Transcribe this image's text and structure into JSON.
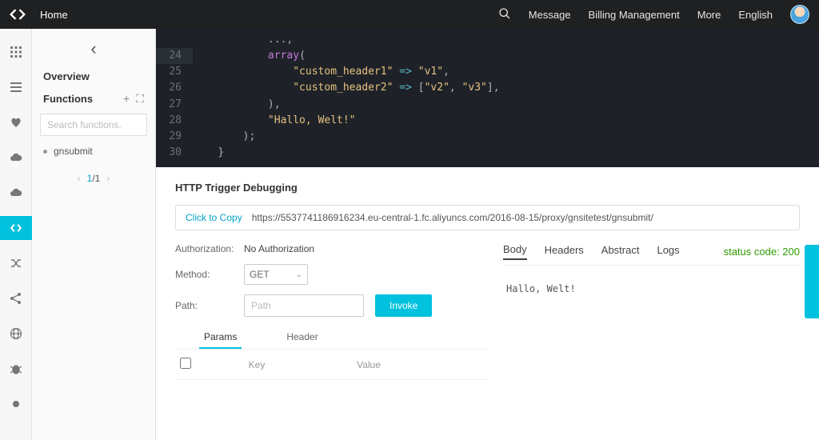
{
  "topbar": {
    "home": "Home",
    "items": [
      "Message",
      "Billing Management",
      "More",
      "English"
    ]
  },
  "sidebar": {
    "overview": "Overview",
    "functions": "Functions",
    "search_placeholder": "Search functions.",
    "fn_name": "gnsubmit",
    "pager_current": "1",
    "pager_total": "/1"
  },
  "code": {
    "lines": [
      {
        "n": "24",
        "ind": "            ",
        "tok": [
          [
            "kw",
            "array"
          ],
          [
            "br",
            "("
          ]
        ]
      },
      {
        "n": "25",
        "ind": "                ",
        "tok": [
          [
            "str",
            "\"custom_header1\""
          ],
          [
            "br",
            " "
          ],
          [
            "op",
            "=>"
          ],
          [
            "br",
            " "
          ],
          [
            "str",
            "\"v1\""
          ],
          [
            "br",
            ","
          ]
        ]
      },
      {
        "n": "26",
        "ind": "                ",
        "tok": [
          [
            "str",
            "\"custom_header2\""
          ],
          [
            "br",
            " "
          ],
          [
            "op",
            "=>"
          ],
          [
            "br",
            " ["
          ],
          [
            "str",
            "\"v2\""
          ],
          [
            "br",
            ", "
          ],
          [
            "str",
            "\"v3\""
          ],
          [
            "br",
            "],"
          ]
        ]
      },
      {
        "n": "27",
        "ind": "            ",
        "tok": [
          [
            "br",
            ")"
          ],
          [
            "br",
            ","
          ]
        ]
      },
      {
        "n": "28",
        "ind": "            ",
        "tok": [
          [
            "str",
            "\"Hallo, Welt!\""
          ]
        ]
      },
      {
        "n": "29",
        "ind": "        ",
        "tok": [
          [
            "br",
            ");"
          ]
        ]
      },
      {
        "n": "30",
        "ind": "    ",
        "tok": [
          [
            "br",
            "}"
          ]
        ]
      }
    ],
    "lead": "            ...,"
  },
  "panel": {
    "title": "HTTP Trigger Debugging",
    "copy": "Click to Copy",
    "url": "https://5537741186916234.eu-central-1.fc.aliyuncs.com/2016-08-15/proxy/gnsitetest/gnsubmit/"
  },
  "form": {
    "auth_label": "Authorization:",
    "auth_value": "No Authorization",
    "method_label": "Method:",
    "method_value": "GET",
    "path_label": "Path:",
    "path_placeholder": "Path",
    "invoke": "Invoke"
  },
  "subtabs": {
    "params": "Params",
    "header": "Header",
    "key": "Key",
    "value": "Value"
  },
  "response": {
    "tabs": [
      "Body",
      "Headers",
      "Abstract",
      "Logs"
    ],
    "status": "status code: 200",
    "body": "Hallo, Welt!"
  }
}
